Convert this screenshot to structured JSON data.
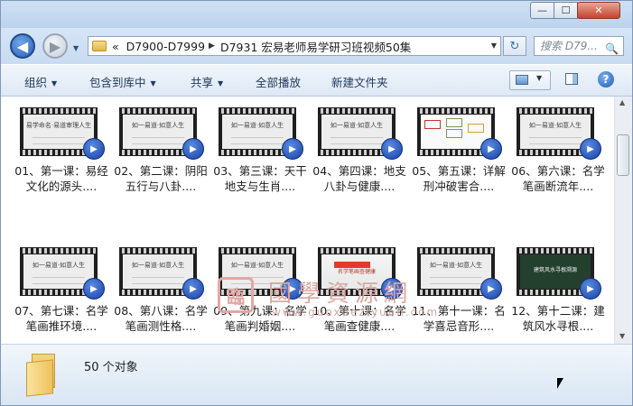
{
  "window": {
    "controls": {
      "minimize": "—",
      "maximize": "☐",
      "close": "✕"
    }
  },
  "nav": {
    "back_glyph": "◀",
    "forward_glyph": "▶",
    "dropdown_glyph": "▼",
    "breadcrumb_overflow": "«",
    "breadcrumbs": [
      "D7900-D7999",
      "D7931 宏易老师易学研习班视频50集"
    ],
    "breadcrumb_separator": "▶",
    "refresh_glyph": "↻",
    "search_placeholder": "搜索 D79...",
    "search_icon_glyph": "🔍"
  },
  "toolbar": {
    "organize": "组织",
    "include_in_library": "包含到库中",
    "share": "共享",
    "play_all": "全部播放",
    "new_folder": "新建文件夹",
    "help_glyph": "?"
  },
  "files": [
    {
      "label": "01、第一课：易经文化的源头....",
      "thumb": "易学命名·易道审理人生",
      "kind": "title"
    },
    {
      "label": "02、第二课：阴阳五行与八卦....",
      "thumb": "如一易道·如意人生",
      "kind": "title"
    },
    {
      "label": "03、第三课：天干地支与生肖....",
      "thumb": "如一易道·如意人生",
      "kind": "title"
    },
    {
      "label": "04、第四课：地支八卦与健康....",
      "thumb": "如一易道·如意人生",
      "kind": "title"
    },
    {
      "label": "05、第五课：详解刑冲破害合....",
      "thumb": "",
      "kind": "chart"
    },
    {
      "label": "06、第六课：名学笔画断流年....",
      "thumb": "如一易道·如意人生",
      "kind": "title"
    },
    {
      "label": "07、第七课：名学笔画推环境....",
      "thumb": "如一易道·如意人生",
      "kind": "title"
    },
    {
      "label": "08、第八课：名学笔画测性格....",
      "thumb": "如一易道·如意人生",
      "kind": "title"
    },
    {
      "label": "09、第九课：名学笔画判婚姻....",
      "thumb": "如一易道·如意人生",
      "kind": "title"
    },
    {
      "label": "10、第十课：名学笔画查健康....",
      "thumb": "名学笔画查健康",
      "kind": "painting"
    },
    {
      "label": "11、第十一课：名学喜忌音形....",
      "thumb": "如一易道·如意人生",
      "kind": "title"
    },
    {
      "label": "12、第十二课：建筑风水寻根....",
      "thumb": "建筑风水寻根溯源",
      "kind": "dark"
    }
  ],
  "watermark": {
    "seal": "臨",
    "title": "國學資源網",
    "url": "www.guoxueziyuan.com"
  },
  "status": {
    "count": "50 个对象"
  },
  "colors": {
    "accent": "#1e395b",
    "window_frame": "#dfe9f5",
    "close_button": "#c5432c"
  }
}
